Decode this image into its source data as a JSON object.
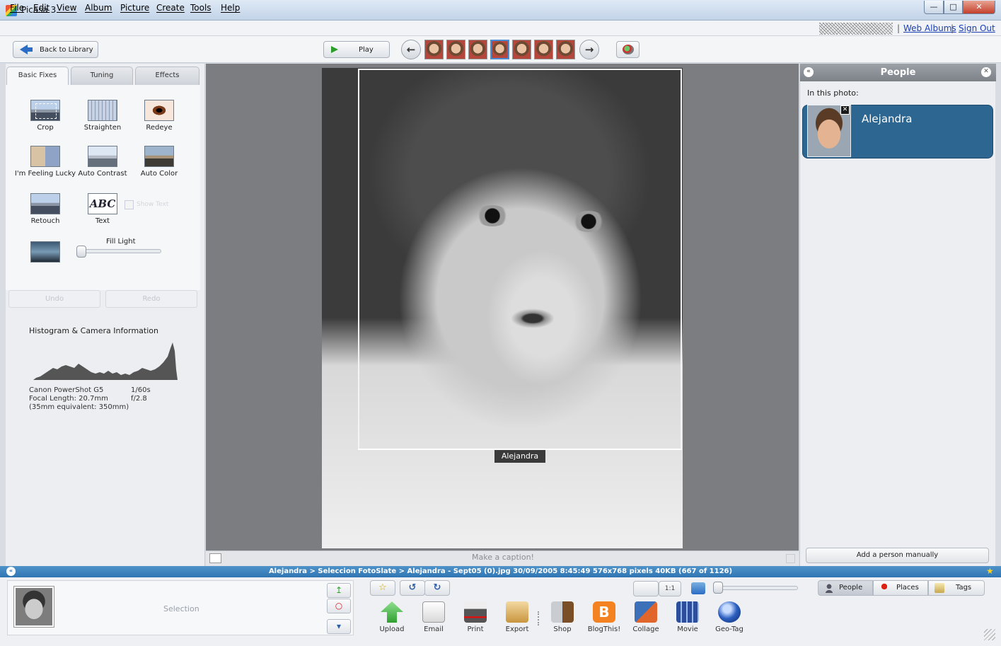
{
  "window": {
    "title": "Picasa 3",
    "min": "—",
    "max": "□",
    "close": "✕"
  },
  "menu": [
    "File",
    "Edit",
    "View",
    "Album",
    "Picture",
    "Create",
    "Tools",
    "Help"
  ],
  "account": {
    "web_albums": "Web Albums",
    "sign_out": "Sign Out",
    "separator": "|"
  },
  "toolbar": {
    "back_label": "Back to Library",
    "play_label": "Play",
    "prev_icon": "arrow-left-icon",
    "next_icon": "arrow-right-icon",
    "prev_glyph": "←",
    "next_glyph": "→",
    "thumbnail_count": 7
  },
  "left_panel": {
    "tabs": [
      "Basic Fixes",
      "Tuning",
      "Effects"
    ],
    "active_tab": "Basic Fixes",
    "tools": {
      "crop": "Crop",
      "straighten": "Straighten",
      "redeye": "Redeye",
      "lucky": "I'm Feeling Lucky",
      "auto_contrast": "Auto Contrast",
      "auto_color": "Auto Color",
      "retouch": "Retouch",
      "text": "Text",
      "text_glyph": "ABC"
    },
    "show_text": "Show Text",
    "fill_light": {
      "label": "Fill Light",
      "value": 0.0
    },
    "undo": "Undo",
    "redo": "Redo",
    "histogram_title": "Histogram & Camera Information",
    "camera": {
      "model": "Canon PowerShot G5",
      "focal": "Focal Length: 20.7mm",
      "equiv": "(35mm equivalent: 350mm)",
      "shutter": "1/60s",
      "aperture": "f/2.8"
    }
  },
  "photo": {
    "face_tag": "Alejandra",
    "caption_placeholder": "Make a caption!"
  },
  "right_panel": {
    "title": "People",
    "collapse_glyph": "«",
    "close_glyph": "✕",
    "in_photo": "In this photo:",
    "person_name": "Alejandra",
    "remove_glyph": "✕",
    "add_person": "Add a person manually"
  },
  "status": {
    "collapse_glyph": "«",
    "text": "Alejandra > Seleccion FotoSlate > Alejandra - Sept05 (0).jpg     30/09/2005 8:45:49     576x768 pixels     40KB     (667 of 1126)",
    "star": "★"
  },
  "tray": {
    "selection_label": "Selection",
    "hold_glyph": "↥",
    "clear_glyph": "○",
    "album_glyph": "▾",
    "star_glyph": "☆",
    "rotate_left_glyph": "↺",
    "rotate_right_glyph": "↻",
    "actions": {
      "upload": "Upload",
      "email": "Email",
      "print": "Print",
      "export": "Export",
      "shop": "Shop",
      "blogthis": "BlogThis!",
      "blog_glyph": "B",
      "collage": "Collage",
      "movie": "Movie",
      "geotag": "Geo-Tag"
    },
    "view_11": "1:1",
    "zoom_value": 0.0,
    "right_tabs": {
      "people": "People",
      "places": "Places",
      "tags": "Tags"
    }
  }
}
